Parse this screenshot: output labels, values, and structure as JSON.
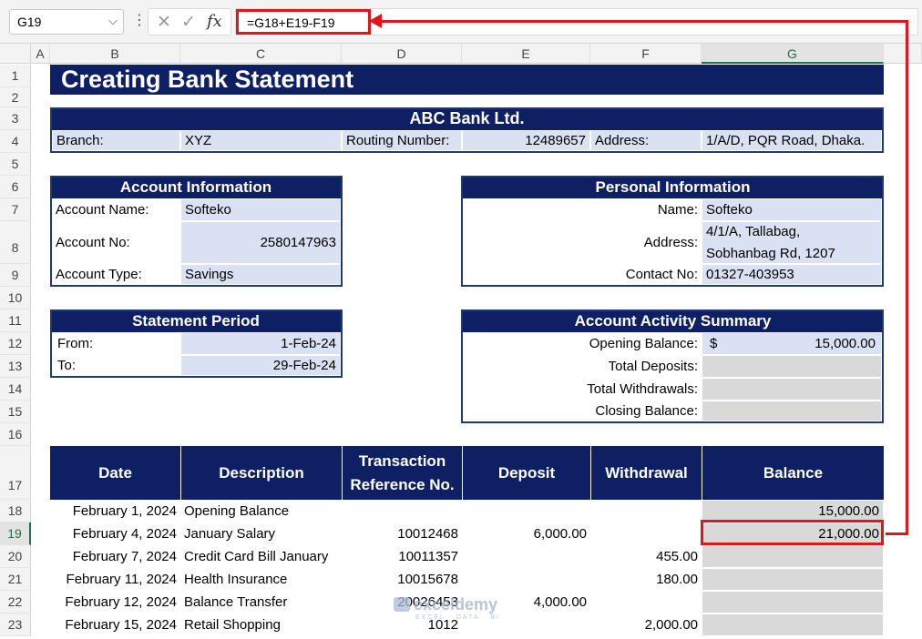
{
  "formula_bar": {
    "name_box": "G19",
    "formula": "=G18+E19-F19",
    "icons": [
      "close-icon",
      "check-icon",
      "fx-icon",
      "chevron-down-icon",
      "more-icon"
    ]
  },
  "columns": [
    "A",
    "B",
    "C",
    "D",
    "E",
    "F",
    "G"
  ],
  "rows": [
    "1",
    "2",
    "3",
    "4",
    "5",
    "6",
    "7",
    "8",
    "9",
    "10",
    "11",
    "12",
    "13",
    "14",
    "15",
    "16",
    "17",
    "18",
    "19",
    "20",
    "21",
    "22",
    "23"
  ],
  "title": "Creating Bank Statement",
  "bank": {
    "name": "ABC Bank Ltd.",
    "branch_label": "Branch:",
    "branch": "XYZ",
    "routing_label": "Routing Number:",
    "routing": "12489657",
    "address_label": "Address:",
    "address": "1/A/D, PQR Road, Dhaka."
  },
  "account_info": {
    "header": "Account Information",
    "name_label": "Account Name:",
    "name": "Softeko",
    "no_label": "Account No:",
    "no": "2580147963",
    "type_label": "Account Type:",
    "type": "Savings"
  },
  "personal_info": {
    "header": "Personal Information",
    "name_label": "Name:",
    "name": "Softeko",
    "address_label": "Address:",
    "address_line1": "4/1/A, Tallabag,",
    "address_line2": "Sobhanbag Rd, 1207",
    "contact_label": "Contact No:",
    "contact": "01327-403953"
  },
  "statement_period": {
    "header": "Statement Period",
    "from_label": "From:",
    "from": "1-Feb-24",
    "to_label": "To:",
    "to": "29-Feb-24"
  },
  "activity_summary": {
    "header": "Account Activity Summary",
    "opening_label": "Opening Balance:",
    "currency": "$",
    "opening": "15,000.00",
    "deposits_label": "Total Deposits:",
    "withdrawals_label": "Total Withdrawals:",
    "closing_label": "Closing Balance:"
  },
  "transactions": {
    "headers": {
      "date": "Date",
      "description": "Description",
      "ref_line1": "Transaction",
      "ref_line2": "Reference No.",
      "deposit": "Deposit",
      "withdrawal": "Withdrawal",
      "balance": "Balance"
    },
    "rows": [
      {
        "date": "February 1, 2024",
        "description": "Opening Balance",
        "ref": "",
        "deposit": "",
        "withdrawal": "",
        "balance": "15,000.00"
      },
      {
        "date": "February 4, 2024",
        "description": "January Salary",
        "ref": "10012468",
        "deposit": "6,000.00",
        "withdrawal": "",
        "balance": "21,000.00"
      },
      {
        "date": "February 7, 2024",
        "description": "Credit Card Bill January",
        "ref": "10011357",
        "deposit": "",
        "withdrawal": "455.00",
        "balance": ""
      },
      {
        "date": "February 11, 2024",
        "description": "Health Insurance",
        "ref": "10015678",
        "deposit": "",
        "withdrawal": "180.00",
        "balance": ""
      },
      {
        "date": "February 12, 2024",
        "description": "Balance Transfer",
        "ref": "20026453",
        "deposit": "4,000.00",
        "withdrawal": "",
        "balance": ""
      },
      {
        "date": "February 15, 2024",
        "description": "Retail Shopping",
        "ref": "1012",
        "deposit": "",
        "withdrawal": "2,000.00",
        "balance": ""
      }
    ]
  },
  "watermark": {
    "name": "exceldemy",
    "tagline": "EXCEL · DATA · BI"
  }
}
